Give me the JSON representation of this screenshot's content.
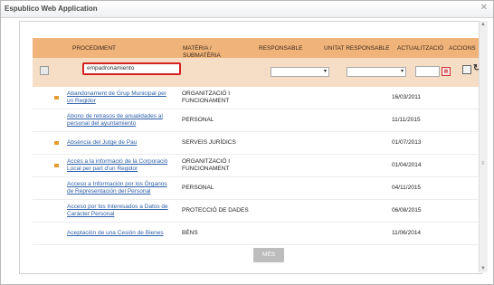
{
  "window": {
    "title": "Espublico Web Application"
  },
  "columns": {
    "procediment": "PROCEDIMENT",
    "materia_line1": "MATÈRIA /",
    "materia_line2": "SUBMATÈRIA",
    "responsable": "RESPONSABLE",
    "unitat": "UNITAT RESPONSABLE",
    "actualitzacio": "ACTUALITZACIÓ",
    "accions": "ACCIONS"
  },
  "filter": {
    "search_value": "empadronamiento"
  },
  "rows": [
    {
      "proc_l1": "Abandonament de Grup Municipal per",
      "proc_l2": "un Regidor",
      "mat_l1": "ORGANITZACIÓ I",
      "mat_l2": "FUNCIONAMENT",
      "date": "16/03/2011"
    },
    {
      "proc_l1": "Abono de retrasos de anualidades al",
      "proc_l2": "personal del ayuntamiento",
      "mat_l1": "PERSONAL",
      "mat_l2": "",
      "date": "11/11/2015"
    },
    {
      "proc_l1": "Absència del Jutge de Pau",
      "proc_l2": "",
      "mat_l1": "SERVEIS JURÍDICS",
      "mat_l2": "",
      "date": "01/07/2013"
    },
    {
      "proc_l1": "Accés a la informació de la Corporació",
      "proc_l2": "Local per part d'un Regidor",
      "mat_l1": "ORGANITZACIÓ I",
      "mat_l2": "FUNCIONAMENT",
      "date": "01/04/2014"
    },
    {
      "proc_l1": "Acceso a Información por los Órganos",
      "proc_l2": "de Representación del Personal",
      "mat_l1": "PERSONAL",
      "mat_l2": "",
      "date": "04/11/2015"
    },
    {
      "proc_l1": "Acceso por los Interesados a Datos de",
      "proc_l2": "Carácter Personal",
      "mat_l1": "PROTECCIÓ DE DADES",
      "mat_l2": "",
      "date": "06/08/2015"
    },
    {
      "proc_l1": "Aceptación de una Cesión de Bienes",
      "proc_l2": "",
      "mat_l1": "BÉNS",
      "mat_l2": "",
      "date": "11/06/2014"
    }
  ],
  "more_label": "MÉS"
}
